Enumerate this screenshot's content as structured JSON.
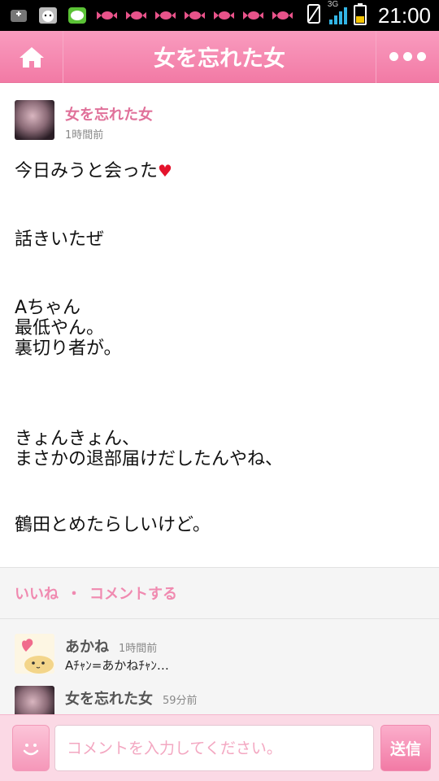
{
  "status_bar": {
    "time": "21:00",
    "network": "3G",
    "notification_icons": [
      "screenshot-icon",
      "cat-app-icon",
      "line-app-icon",
      "candy-icon",
      "candy-icon",
      "candy-icon",
      "candy-icon",
      "candy-icon",
      "candy-icon",
      "candy-icon"
    ]
  },
  "header": {
    "title": "女を忘れた女"
  },
  "post": {
    "author": "女を忘れた女",
    "time": "1時間前",
    "body": {
      "p1": "今日みうと会った",
      "p2": "話きいたぜ",
      "p3": "Aちゃん\n最低やん。\n裏切り者が。",
      "p4": "きょんきょん、\nまさかの退部届けだしたんやね、",
      "p5": "鶴田とめたらしいけど。"
    }
  },
  "actions": {
    "like": "いいね",
    "separator": "・",
    "comment": "コメントする"
  },
  "comments": [
    {
      "name": "あかね",
      "time": "1時間前",
      "text": "Aﾁｬﾝ=あかねﾁｬﾝ…"
    },
    {
      "name": "女を忘れた女",
      "time": "59分前",
      "text": ""
    }
  ],
  "input": {
    "placeholder": "コメントを入力してください。",
    "value": "",
    "send_label": "送信"
  },
  "colors": {
    "accent": "#f27aa5",
    "author": "#e0719a",
    "heart": "#e4132c"
  }
}
